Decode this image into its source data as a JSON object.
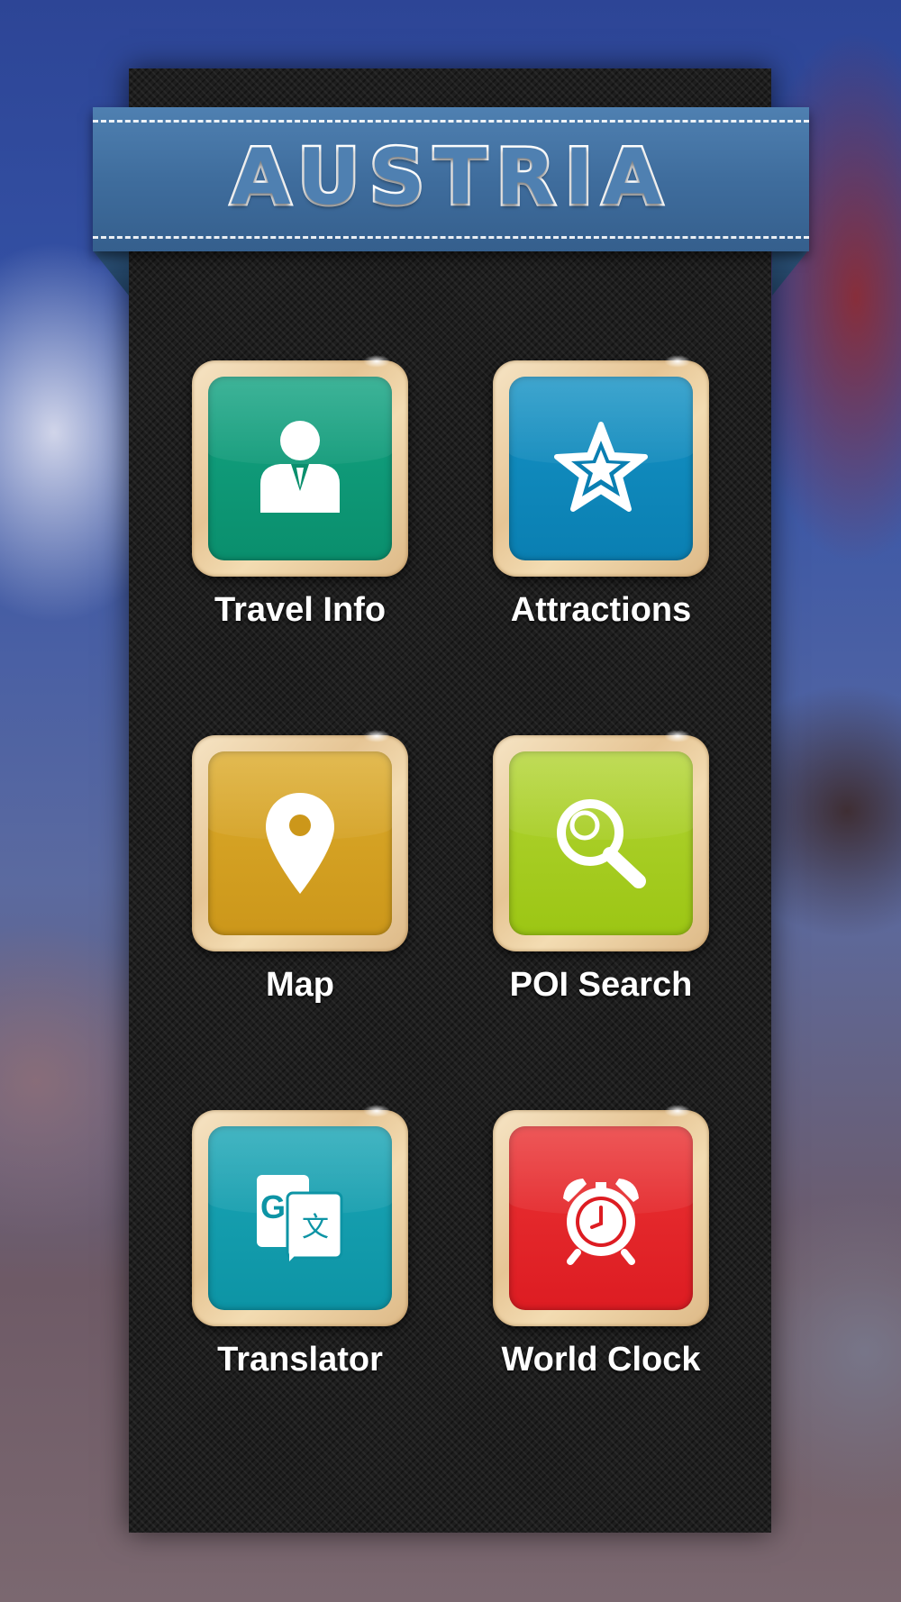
{
  "header": {
    "title": "AUSTRIA"
  },
  "menu": {
    "items": [
      {
        "label": "Travel Info",
        "icon": "person-icon",
        "color": "#0a8f6d"
      },
      {
        "label": "Attractions",
        "icon": "star-icon",
        "color": "#0a7fb2"
      },
      {
        "label": "Map",
        "icon": "map-pin-icon",
        "color": "#cc971a"
      },
      {
        "label": "POI Search",
        "icon": "search-icon",
        "color": "#9cc614"
      },
      {
        "label": "Translator",
        "icon": "translate-icon",
        "color": "#0d94a5"
      },
      {
        "label": "World Clock",
        "icon": "alarm-clock-icon",
        "color": "#dd1c22"
      }
    ]
  }
}
